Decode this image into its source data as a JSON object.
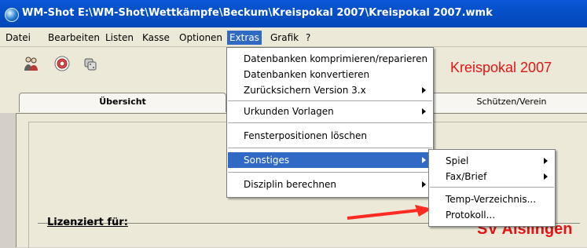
{
  "title_bar": {
    "title": "WM-Shot E:\\WM-Shot\\Wettkämpfe\\Beckum\\Kreispokal 2007\\Kreispokal 2007.wmk"
  },
  "menubar": {
    "items": [
      {
        "label": "Datei"
      },
      {
        "label": "Bearbeiten"
      },
      {
        "label": "Listen"
      },
      {
        "label": "Kasse"
      },
      {
        "label": "Optionen"
      },
      {
        "label": "Extras"
      },
      {
        "label": "Grafik"
      },
      {
        "label": "?"
      }
    ]
  },
  "toolbar": {
    "icons": [
      "people-icon",
      "target-icon",
      "dice-icon"
    ],
    "banner_title": "Kreispokal 2007"
  },
  "tabs": [
    {
      "label": "Übersicht"
    },
    {
      "label": "Schützen/Verein"
    }
  ],
  "content": {
    "lizenz_label": "Lizenziert für:",
    "club_name": "SV Aislingen"
  },
  "extras_menu": {
    "items": [
      {
        "label": "Datenbanken komprimieren/reparieren"
      },
      {
        "label": "Datenbanken konvertieren"
      },
      {
        "label": "Zurücksichern Version 3.x"
      },
      {
        "label": "Urkunden Vorlagen"
      },
      {
        "label": "Fensterpositionen löschen"
      },
      {
        "label": "Sonstiges"
      },
      {
        "label": "Disziplin berechnen"
      }
    ]
  },
  "sonstiges_menu": {
    "items": [
      {
        "label": "Spiel"
      },
      {
        "label": "Fax/Brief"
      },
      {
        "label": "Temp-Verzeichnis..."
      },
      {
        "label": "Protokoll..."
      }
    ]
  },
  "colors": {
    "titlebar": "#0550c8",
    "menu_highlight": "#316ac5",
    "banner_red": "#e21515",
    "logo_blue": "#1b2db8"
  }
}
